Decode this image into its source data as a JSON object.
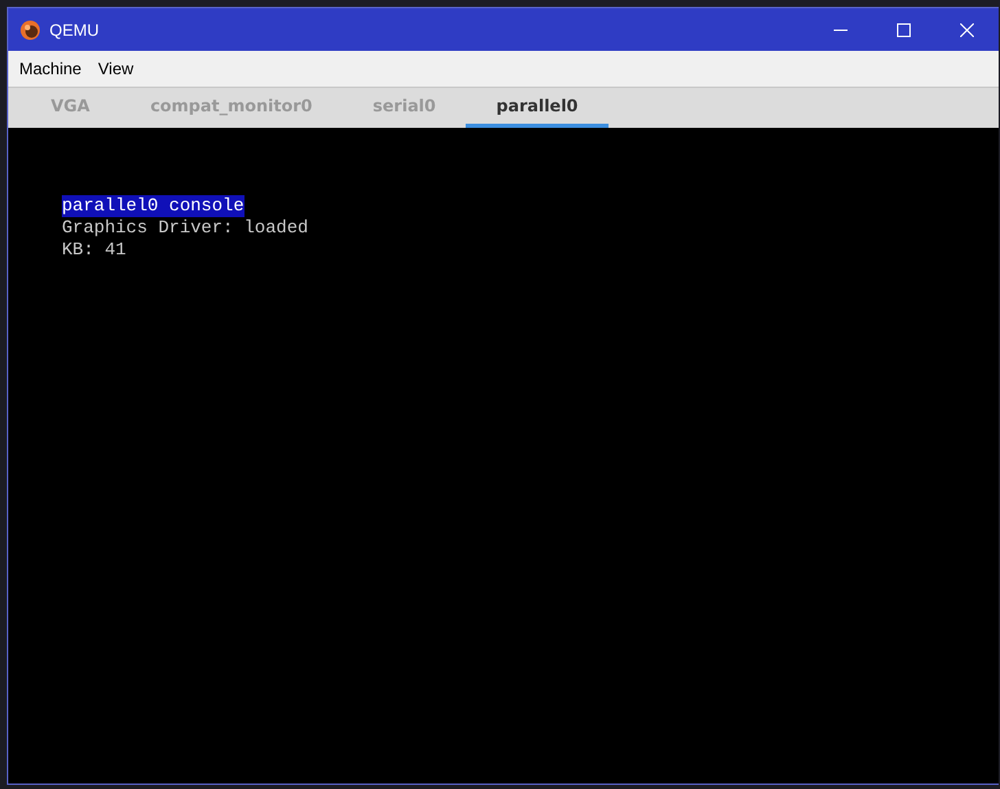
{
  "window": {
    "title": "QEMU"
  },
  "menu": [
    "Machine",
    "View"
  ],
  "tabs": [
    {
      "label": "VGA",
      "selected": false
    },
    {
      "label": "compat_monitor0",
      "selected": false
    },
    {
      "label": "serial0",
      "selected": false
    },
    {
      "label": "parallel0",
      "selected": true
    }
  ],
  "console": [
    {
      "text": "parallel0 console",
      "highlighted": true
    },
    {
      "text": "Graphics Driver: loaded",
      "highlighted": false
    },
    {
      "text": "KB: 41",
      "highlighted": false
    }
  ]
}
